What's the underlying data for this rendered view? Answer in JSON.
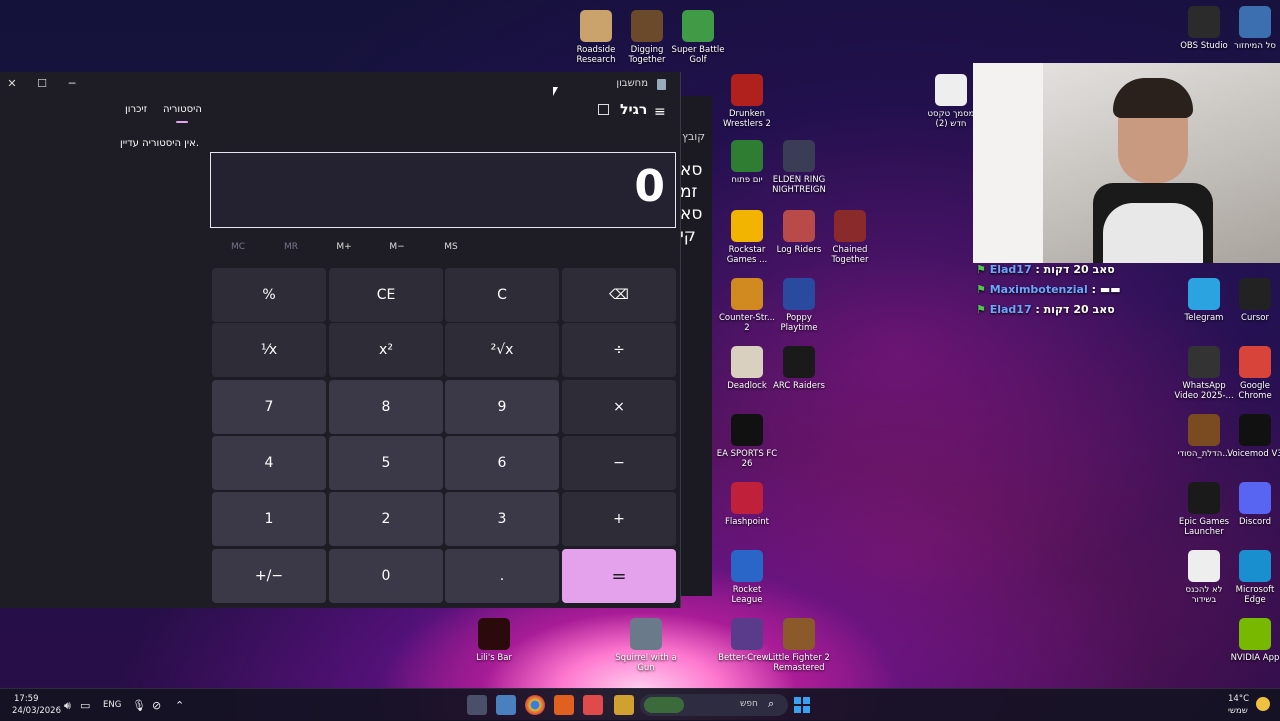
{
  "desktop": {
    "icons": [
      {
        "label": "Roadside Research",
        "color": "#c9a36b"
      },
      {
        "label": "Digging Together",
        "color": "#6a4a2a"
      },
      {
        "label": "Super Battle Golf",
        "color": "#3f9b45"
      },
      {
        "label": "OBS Studio",
        "color": "#2b2b2b"
      },
      {
        "label": "סל המיחזור",
        "color": "#3b6fb0"
      },
      {
        "label": "Drunken Wrestlers 2",
        "color": "#b0201c"
      },
      {
        "label": "מסמך טקסט חדש (2)",
        "color": "#eeeeee"
      },
      {
        "label": "יום פתוח",
        "color": "#2e7d32"
      },
      {
        "label": "ELDEN RING NIGHTREIGN",
        "color": "#3a3d55"
      },
      {
        "label": "Rockstar Games ...",
        "color": "#f2b400"
      },
      {
        "label": "Log Riders",
        "color": "#b84a4a"
      },
      {
        "label": "Chained Together",
        "color": "#8a2a2a"
      },
      {
        "label": "Counter-Str... 2",
        "color": "#d08a20"
      },
      {
        "label": "Poppy Playtime",
        "color": "#2a4aa0"
      },
      {
        "label": "Deadlock",
        "color": "#d9d0c0"
      },
      {
        "label": "ARC Raiders",
        "color": "#1a1a1a"
      },
      {
        "label": "EA SPORTS FC 26",
        "color": "#111111"
      },
      {
        "label": "Flashpoint",
        "color": "#c0203a"
      },
      {
        "label": "Rocket League",
        "color": "#2a66c8"
      },
      {
        "label": "Telegram",
        "color": "#2aa3e0"
      },
      {
        "label": "Cursor",
        "color": "#222222"
      },
      {
        "label": "WhatsApp Video 2025-...",
        "color": "#333333"
      },
      {
        "label": "Google Chrome",
        "color": "#d9443a"
      },
      {
        "label": "הדלת_הסודי...",
        "color": "#7a4a20"
      },
      {
        "label": "Voicemod V3",
        "color": "#111111"
      },
      {
        "label": "Epic Games Launcher",
        "color": "#1a1a1a"
      },
      {
        "label": "Discord",
        "color": "#5865f2"
      },
      {
        "label": "לא להכנס בשידור",
        "color": "#eeeeee"
      },
      {
        "label": "Microsoft Edge",
        "color": "#1a8fd0"
      },
      {
        "label": "NVIDIA App",
        "color": "#76b900"
      },
      {
        "label": "Lili's Bar",
        "color": "#2a0a0a"
      },
      {
        "label": "Squirrel with a Gun",
        "color": "#6a7a8a"
      },
      {
        "label": "Better-Crew...",
        "color": "#5a3a8a"
      },
      {
        "label": "Little Fighter 2 Remastered",
        "color": "#8a5a2a"
      }
    ],
    "behind_window_text": [
      "קובץ",
      "סא",
      "זמ",
      "סא",
      "קי"
    ]
  },
  "calculator": {
    "title": "מחשבון",
    "mode": "רגיל",
    "tabs": {
      "history": "היסטוריה",
      "memory": "זיכרון"
    },
    "history_empty": "אין היסטוריה עדיין.",
    "display": "0",
    "memory_buttons": [
      "MC",
      "MR",
      "M+",
      "M−",
      "MS"
    ],
    "keys": [
      [
        "%",
        "CE",
        "C",
        "⌫"
      ],
      [
        "¹⁄x",
        "x²",
        "²√x",
        "÷"
      ],
      [
        "7",
        "8",
        "9",
        "×"
      ],
      [
        "4",
        "5",
        "6",
        "−"
      ],
      [
        "1",
        "2",
        "3",
        "+"
      ],
      [
        "+/−",
        "0",
        ".",
        "="
      ]
    ],
    "accent": "#e4a2ec"
  },
  "chat": [
    {
      "user": "Elad17",
      "message": "סאב 20 דקות",
      "color": "#6aa8ff"
    },
    {
      "user": "Maximbotenzial",
      "message": "▬▬",
      "color": "#6aa8ff"
    },
    {
      "user": "Elad17",
      "message": "סאב 20 דקות",
      "color": "#6aa8ff"
    }
  ],
  "taskbar": {
    "time": "17:59",
    "date": "24/03/2026",
    "lang": "ENG",
    "search": "חפש",
    "weather_temp": "14°C",
    "weather_desc": "שמשי"
  }
}
